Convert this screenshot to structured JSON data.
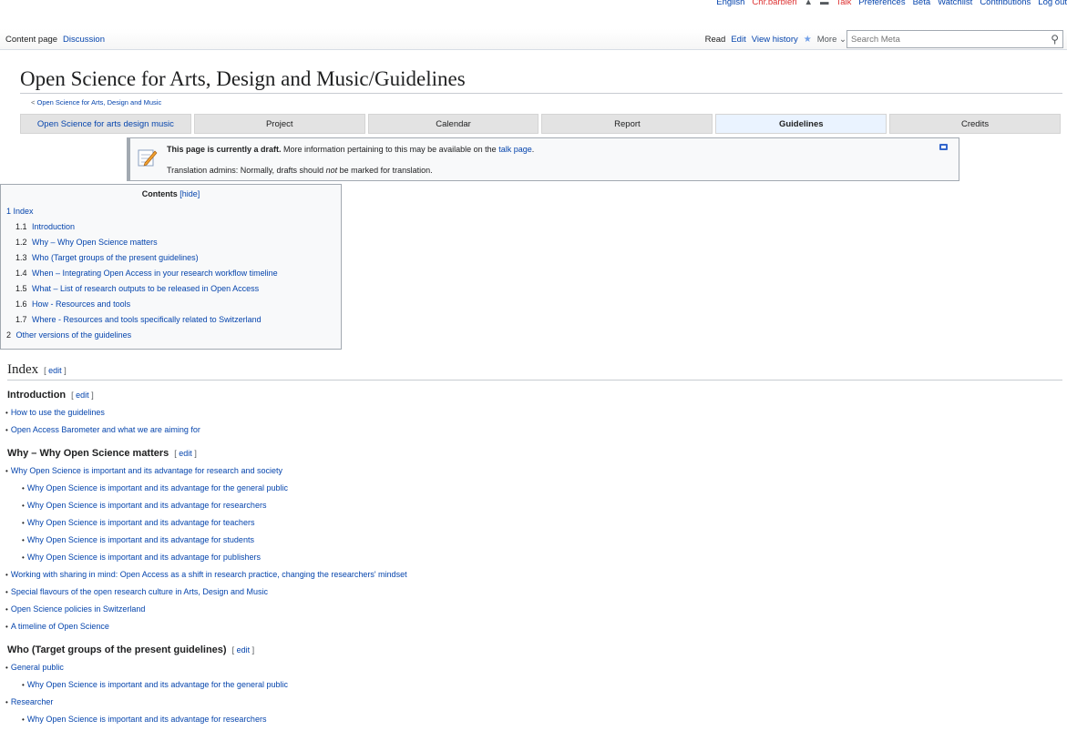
{
  "personal_tools": {
    "language": "English",
    "username": "Chr.barbieri",
    "talk": "Talk",
    "preferences": "Preferences",
    "beta": "Beta",
    "watchlist": "Watchlist",
    "contributions": "Contributions",
    "logout": "Log out"
  },
  "tabs": {
    "content_page": "Content page",
    "discussion": "Discussion",
    "read": "Read",
    "edit": "Edit",
    "view_history": "View history",
    "more": "More"
  },
  "search": {
    "placeholder": "Search Meta",
    "value": ""
  },
  "page": {
    "title": "Open Science for Arts, Design and Music/Guidelines",
    "subpage_arrow": "<",
    "subpage_link": "Open Science for Arts, Design and Music"
  },
  "nav_tabs": [
    "Open Science for arts design music",
    "Project",
    "Calendar",
    "Report",
    "Guidelines",
    "Credits"
  ],
  "notice": {
    "bold": "This page is currently a draft.",
    "text1": " More information pertaining to this may be available on the ",
    "talk_link": "talk page",
    "text1_end": ".",
    "line2_a": "Translation admins: Normally, drafts should ",
    "line2_em": "not",
    "line2_b": " be marked for translation."
  },
  "toc": {
    "title": "Contents",
    "hide": "[hide]",
    "items": [
      {
        "num": "1",
        "label": "Index",
        "level": 1
      },
      {
        "num": "1.1",
        "label": "Introduction",
        "level": 2
      },
      {
        "num": "1.2",
        "label": "Why – Why Open Science matters",
        "level": 2
      },
      {
        "num": "1.3",
        "label": "Who (Target groups of the present guidelines)",
        "level": 2
      },
      {
        "num": "1.4",
        "label": "When – Integrating Open Access in your research workflow timeline",
        "level": 2
      },
      {
        "num": "1.5",
        "label": "What – List of research outputs to be released in Open Access",
        "level": 2
      },
      {
        "num": "1.6",
        "label": "How - Resources and tools",
        "level": 2
      },
      {
        "num": "1.7",
        "label": "Where - Resources and tools specifically related to Switzerland",
        "level": 2
      },
      {
        "num": "2",
        "label": "Other versions of the guidelines",
        "level": 1
      }
    ]
  },
  "edit_label": "edit",
  "sections": {
    "index": "Index",
    "introduction": {
      "heading": "Introduction",
      "items": [
        "How to use the guidelines",
        "Open Access Barometer and what we are aiming for"
      ]
    },
    "why": {
      "heading": "Why – Why Open Science matters",
      "items": [
        {
          "label": "Why Open Science is important and its advantage for research and society",
          "sub": false
        },
        {
          "label": "Why Open Science is important and its advantage for the general public",
          "sub": true
        },
        {
          "label": "Why Open Science is important and its advantage for researchers",
          "sub": true
        },
        {
          "label": "Why Open Science is important and its advantage for teachers",
          "sub": true
        },
        {
          "label": "Why Open Science is important and its advantage for students",
          "sub": true
        },
        {
          "label": "Why Open Science is important and its advantage for publishers",
          "sub": true
        },
        {
          "label": "Working with sharing in mind: Open Access as a shift in research practice, changing the researchers' mindset",
          "sub": false
        },
        {
          "label": "Special flavours of the open research culture in Arts, Design and Music",
          "sub": false
        },
        {
          "label": "Open Science policies in Switzerland",
          "sub": false
        },
        {
          "label": "A timeline of Open Science",
          "sub": false
        }
      ]
    },
    "who": {
      "heading": "Who (Target groups of the present guidelines)",
      "items": [
        {
          "label": "General public",
          "sub": false
        },
        {
          "label": "Why Open Science is important and its advantage for the general public",
          "sub": true
        },
        {
          "label": "Researcher",
          "sub": false
        },
        {
          "label": "Why Open Science is important and its advantage for researchers",
          "sub": true
        }
      ]
    }
  }
}
